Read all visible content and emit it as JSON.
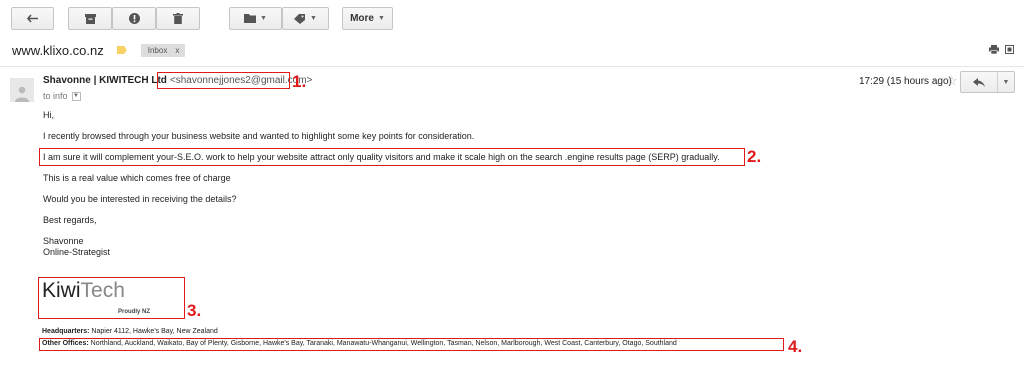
{
  "toolbar": {
    "buttons": [
      {
        "name": "back",
        "icon": "back-arrow-icon"
      },
      {
        "name": "archive",
        "icon": "archive-icon"
      },
      {
        "name": "report-spam",
        "icon": "report-spam-icon"
      },
      {
        "name": "delete",
        "icon": "trash-icon"
      },
      {
        "name": "move-to",
        "icon": "folder-icon"
      },
      {
        "name": "labels",
        "icon": "label-icon"
      }
    ],
    "more_label": "More"
  },
  "header": {
    "subject": "www.klixo.co.nz",
    "label_color": "#fad165",
    "chip_label": "Inbox",
    "chip_close": "x"
  },
  "message": {
    "sender_name": "Shavonne | KIWITECH Ltd",
    "sender_email": "<shavonnejjones2@gmail.com>",
    "to_text": "to info",
    "time": "17:29 (15 hours ago)",
    "greeting": "Hi,",
    "para1": "I recently browsed through your business website and wanted to highlight some key points for consideration.",
    "para2": "I am sure it will complement your-S.E.O. work to help your website attract only quality visitors and make it scale high on the search .engine results page (SERP) gradually.",
    "para3": "This is a real value which comes free of charge",
    "para4": "Would you be interested in receiving the details?",
    "closing": "Best regards,",
    "sig_name": "Shavonne",
    "sig_title": "Online-Strategist"
  },
  "signature": {
    "logo_part1": "Kiwi",
    "logo_part2": "Tech",
    "tagline": "Proudly NZ",
    "hq_label": "Headquarters:",
    "hq_value": "Napier 4112, Hawke's Bay, New Zealand",
    "offices_label": "Other Offices:",
    "offices_value": "Northland, Auckland, Waikato, Bay of Plenty, Gisborne, Hawke's Bay, Taranaki, Manawatu-Whanganui, Wellington, Tasman, Nelson, Marlborough, West Coast, Canterbury, Otago, Southland"
  },
  "annotations": {
    "marker1": "1.",
    "marker2": "2.",
    "marker3": "3.",
    "marker4": "4.",
    "color": "#e01a1a"
  }
}
